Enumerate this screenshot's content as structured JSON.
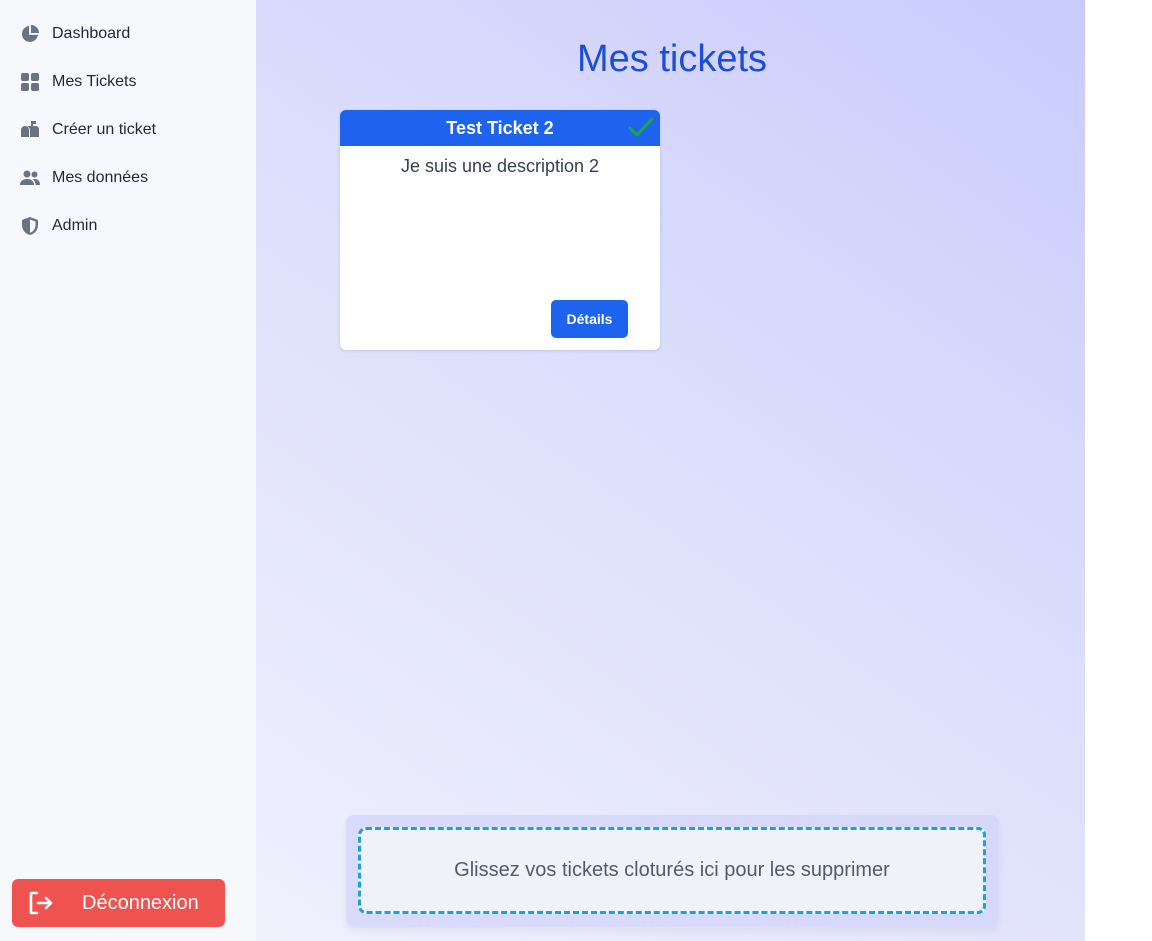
{
  "sidebar": {
    "items": [
      {
        "label": "Dashboard",
        "icon": "pie-chart-icon"
      },
      {
        "label": "Mes Tickets",
        "icon": "grid-icon"
      },
      {
        "label": "Créer un ticket",
        "icon": "mailbox-icon"
      },
      {
        "label": "Mes données",
        "icon": "users-icon"
      },
      {
        "label": "Admin",
        "icon": "shield-icon"
      }
    ],
    "logout_label": "Déconnexion"
  },
  "main": {
    "title": "Mes tickets",
    "tickets": [
      {
        "title": "Test Ticket 2",
        "description": "Je suis une description 2",
        "details_label": "Détails",
        "status_icon": "check-icon"
      }
    ],
    "drop_zone_text": "Glissez vos tickets cloturés ici pour les supprimer"
  },
  "colors": {
    "accent": "#1d63ed",
    "title": "#1d4ed8",
    "logout": "#ef5350",
    "check": "#22a447",
    "drop_border": "#1aa2dc"
  }
}
